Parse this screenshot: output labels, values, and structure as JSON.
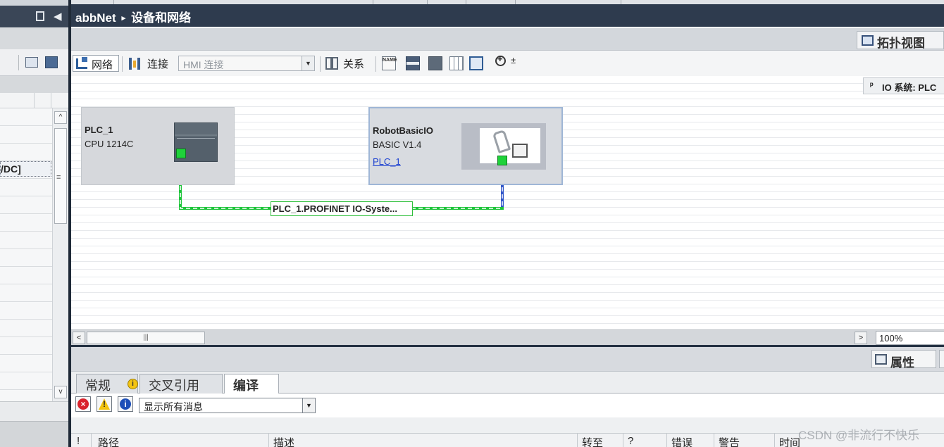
{
  "editor": {
    "title": "abbNet",
    "breadcrumb_sep": "▸",
    "subtitle": "设备和网络"
  },
  "view_tabs": {
    "topology": "拓扑视图"
  },
  "toolbar": {
    "network": "网络",
    "connections": "连接",
    "hmi_connection": "HMI 连接",
    "relations": "关系",
    "name_icon": "NAME",
    "zoom_arrow": "±"
  },
  "left_pane": {
    "selected_row_fragment": "/DC]",
    "scroll_up": "^",
    "scroll_down": "v",
    "grip": "≡"
  },
  "canvas": {
    "io_system_label": "IO 系统: PLC",
    "devices": [
      {
        "name": "PLC_1",
        "type": "CPU 1214C",
        "link": ""
      },
      {
        "name": "RobotBasicIO",
        "type": "BASIC V1.4",
        "link": "PLC_1"
      }
    ],
    "subnet_label": "PLC_1.PROFINET IO-Syste...",
    "colors": {
      "subnet": "#1ec43a",
      "io_line": "#2f55c8",
      "port": "#1fd23a"
    }
  },
  "hscroll": {
    "left": "<",
    "right": ">",
    "grip": "|||"
  },
  "zoom": "100%",
  "inspector": {
    "properties_label": "属性",
    "tabs": [
      {
        "label": "常规",
        "badge": "i"
      },
      {
        "label": "交叉引用"
      },
      {
        "label": "编译"
      }
    ],
    "filter_icons": [
      "error-icon",
      "warning-icon",
      "info-icon"
    ],
    "filter_glyphs": [
      "×",
      "!",
      "i"
    ],
    "filter_value": "显示所有消息",
    "columns": [
      "!",
      "路径",
      "描述",
      "转至",
      "?",
      "错误",
      "警告",
      "时间"
    ]
  },
  "watermark": "CSDN @非流行不快乐"
}
